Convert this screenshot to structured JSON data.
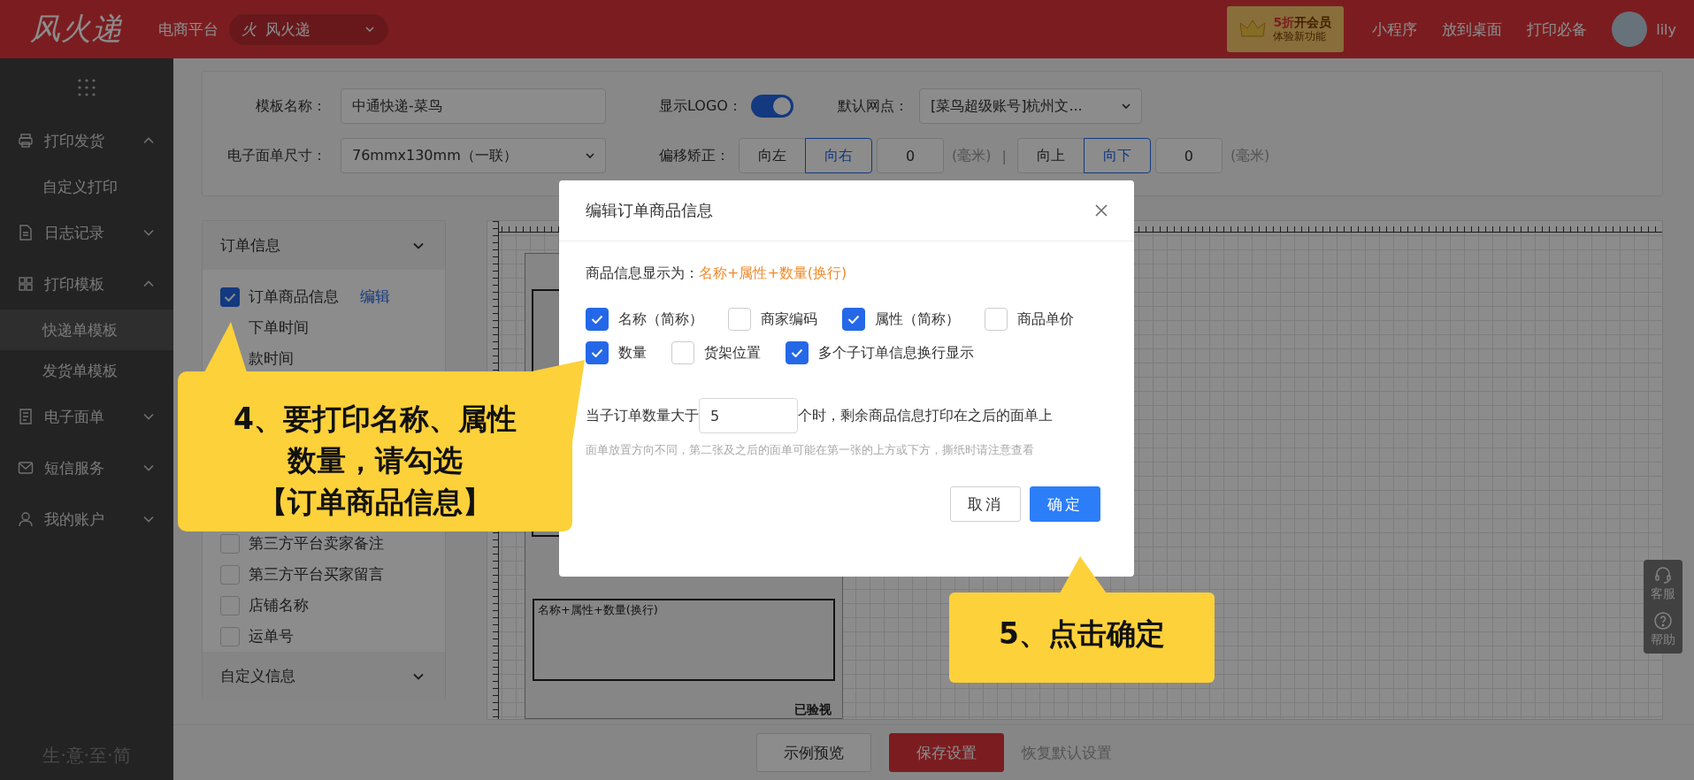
{
  "header": {
    "logo": "风火递",
    "platform_label": "电商平台",
    "platform_select": {
      "icon_char": "火",
      "value": "风火递"
    },
    "vip": {
      "highlight": "5折",
      "title": "开会员",
      "subtitle": "体验新功能"
    },
    "links": [
      "小程序",
      "放到桌面",
      "打印必备"
    ],
    "user": "lily"
  },
  "sidebar": {
    "items": [
      {
        "label": "打印发货",
        "kind": "printer",
        "expanded": true,
        "children": [
          {
            "label": "自定义打印",
            "selected": false
          }
        ]
      },
      {
        "label": "日志记录",
        "kind": "document",
        "expanded": false
      },
      {
        "label": "打印模板",
        "kind": "grid",
        "expanded": true,
        "children": [
          {
            "label": "快递单模板",
            "selected": true
          },
          {
            "label": "发货单模板",
            "selected": false
          }
        ]
      },
      {
        "label": "电子面单",
        "kind": "receipt",
        "expanded": false
      },
      {
        "label": "短信服务",
        "kind": "mail",
        "expanded": false
      },
      {
        "label": "我的账户",
        "kind": "user",
        "expanded": false
      }
    ],
    "slogan": "生·意·至·简"
  },
  "settings": {
    "template_name": {
      "label": "模板名称：",
      "value": "中通快递-菜鸟"
    },
    "show_logo": {
      "label": "显示LOGO：",
      "on": true
    },
    "default_outlet": {
      "label": "默认网点：",
      "value": "[菜鸟超级账号]杭州文..."
    },
    "size": {
      "label": "电子面单尺寸：",
      "value": "76mmx130mm（一联）"
    },
    "offset": {
      "label": "偏移矫正：",
      "separator": "|",
      "groups": [
        {
          "options": [
            {
              "label": "向左",
              "selected": false
            },
            {
              "label": "向右",
              "selected": true
            }
          ],
          "value": "0",
          "unit": "(毫米)"
        },
        {
          "options": [
            {
              "label": "向上",
              "selected": false
            },
            {
              "label": "向下",
              "selected": true
            }
          ],
          "value": "0",
          "unit": "(毫米)"
        }
      ]
    }
  },
  "field_panel": {
    "title": "订单信息",
    "items": [
      {
        "label": "订单商品信息",
        "checked": true,
        "action": "编辑"
      },
      {
        "label": "下单时间"
      },
      {
        "label": "款时间"
      },
      {
        "label": "第三方平台卖家备注",
        "checked": false
      },
      {
        "label": "第三方平台买家留言",
        "checked": false
      },
      {
        "label": "店铺名称",
        "checked": false
      },
      {
        "label": "运单号",
        "checked": false
      }
    ],
    "footer_title": "自定义信息"
  },
  "preview": {
    "product_field": "名称+属性+数量(换行)",
    "inspected": "已验视"
  },
  "help_widget": [
    {
      "label": "客服",
      "kind": "headset"
    },
    {
      "label": "帮助",
      "kind": "question"
    }
  ],
  "footer_buttons": [
    {
      "label": "示例预览",
      "kind": "default"
    },
    {
      "label": "保存设置",
      "kind": "primary"
    },
    {
      "label": "恢复默认设置",
      "kind": "link"
    }
  ],
  "modal": {
    "title": "编辑订单商品信息",
    "display_label": "商品信息显示为：",
    "display_value": "名称+属性+数量(换行)",
    "option_rows": [
      [
        {
          "label": "名称（简称）",
          "checked": true
        },
        {
          "label": "商家编码",
          "checked": false
        },
        {
          "label": "属性（简称）",
          "checked": true
        },
        {
          "label": "商品单价",
          "checked": false
        }
      ],
      [
        {
          "label": "数量",
          "checked": true
        },
        {
          "label": "货架位置",
          "checked": false
        },
        {
          "label": "多个子订单信息换行显示",
          "checked": true
        }
      ]
    ],
    "limit_before": "当子订单数量大于",
    "limit_value": "5",
    "limit_after": "个时，剩余商品信息打印在之后的面单上",
    "hint": "面单放置方向不同，第二张及之后的面单可能在第一张的上方或下方，撕纸时请注意查看",
    "buttons": [
      {
        "label": "取消",
        "kind": "default"
      },
      {
        "label": "确定",
        "kind": "primary"
      }
    ]
  },
  "callouts": [
    {
      "kind": "double-pointer",
      "lines": [
        "4、要打印名称、属性",
        "数量，请勾选",
        "【订单商品信息】"
      ]
    },
    {
      "kind": "up-pointer",
      "lines": [
        "5、点击确定"
      ]
    }
  ]
}
